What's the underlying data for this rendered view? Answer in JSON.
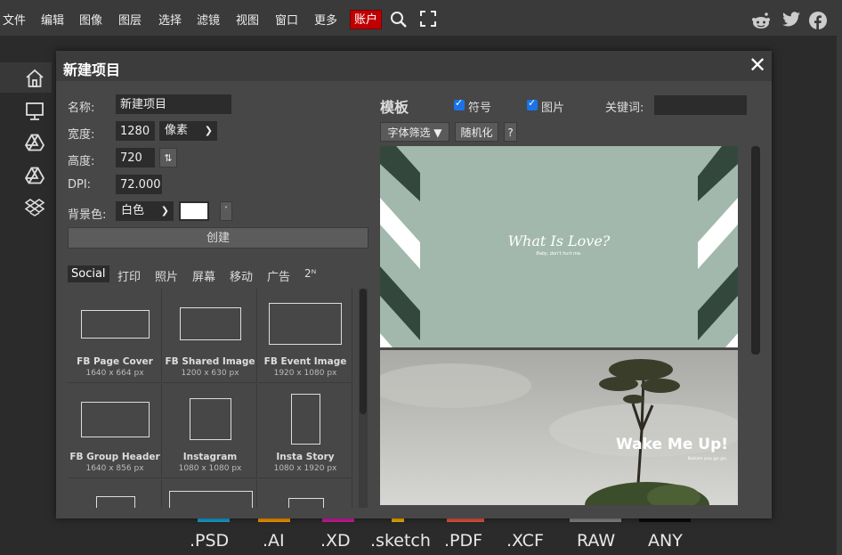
{
  "menu": {
    "items": [
      "文件",
      "编辑",
      "图像",
      "图层",
      "选择",
      "滤镜",
      "视图",
      "窗口",
      "更多"
    ],
    "account": "账户",
    "accent": "#c00000"
  },
  "toolbar_icons": [
    "home-icon",
    "monitor-icon",
    "google-drive-icon",
    "google-drive-alt-icon",
    "dropbox-icon"
  ],
  "formats": [
    ".PSD",
    ".AI",
    ".XD",
    ".sketch",
    ".PDF",
    ".XCF",
    "RAW",
    "ANY"
  ],
  "dialog": {
    "title": "新建项目",
    "close": "✕",
    "name_label": "名称:",
    "name_value": "新建项目",
    "width_label": "宽度:",
    "width_value": "1280",
    "unit": "像素",
    "height_label": "高度:",
    "height_value": "720",
    "swap": "⇅",
    "dpi_label": "DPI:",
    "dpi_value": "72.000",
    "bg_label": "背景色:",
    "bg_value": "白色",
    "bg_color": "#ffffff",
    "create_label": "创建",
    "tabs": [
      "Social",
      "打印",
      "照片",
      "屏幕",
      "移动",
      "广告",
      "2ᴺ"
    ],
    "presets": [
      {
        "name": "FB Page Cover",
        "size": "1640 x 664 px"
      },
      {
        "name": "FB Shared Image",
        "size": "1200 x 630 px"
      },
      {
        "name": "FB Event Image",
        "size": "1920 x 1080 px"
      },
      {
        "name": "FB Group Header",
        "size": "1640 x 856 px"
      },
      {
        "name": "Instagram",
        "size": "1080 x 1080 px"
      },
      {
        "name": "Insta Story",
        "size": "1080 x 1920 px"
      }
    ],
    "templates_title": "模板",
    "symbols_label": "符号",
    "images_label": "图片",
    "keyword_label": "关键词:",
    "keyword_value": "",
    "font_filter": "字体筛选 ▼",
    "randomize": "随机化",
    "help": "?",
    "template1": {
      "title": "What Is Love?",
      "subtitle": "Baby, don't hurt me."
    },
    "template2": {
      "title": "Wake Me Up!",
      "subtitle": "Before you go go."
    }
  }
}
